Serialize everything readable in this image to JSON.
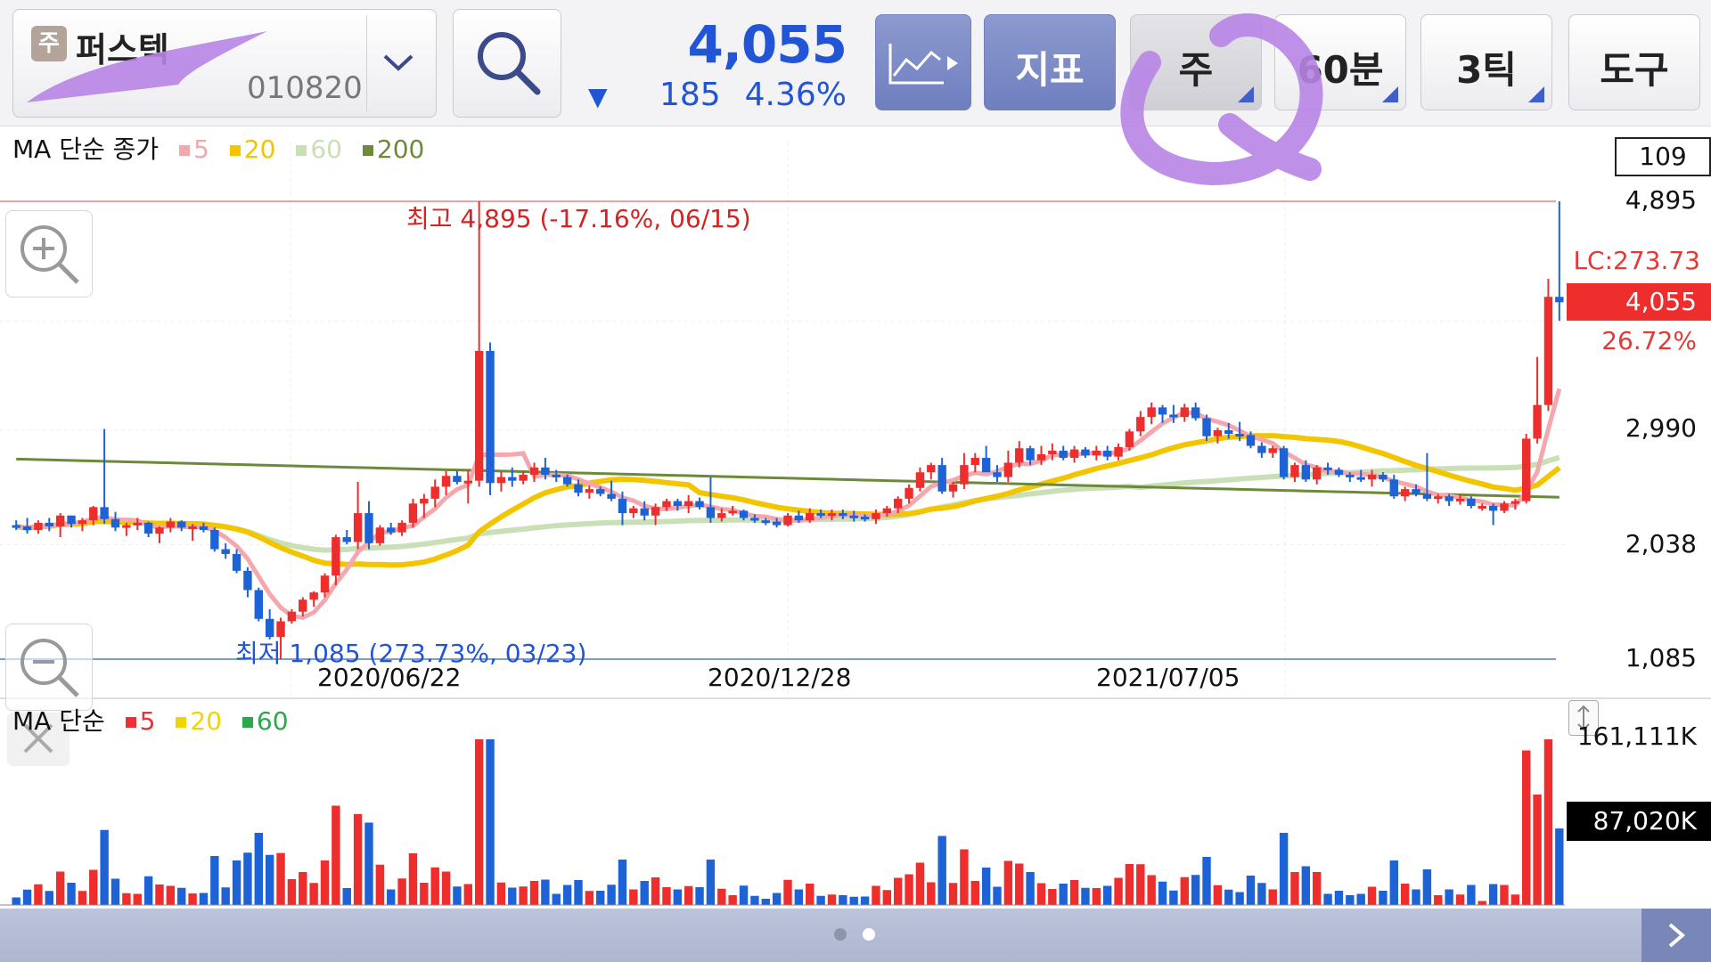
{
  "stock": {
    "badge": "주",
    "name": "퍼스텍",
    "code": "010820"
  },
  "quote": {
    "price": "4,055",
    "direction_arrow": "▼",
    "change": "185",
    "change_pct": "4.36%"
  },
  "toolbar": {
    "indicator_label": "지표",
    "period_label": "주",
    "minute_label": "60분",
    "tick_label": "3틱",
    "tools_label": "도구"
  },
  "price_panel": {
    "legend_title": "MA 단순 종가",
    "legend": [
      {
        "label": "5",
        "color": "#f4a7ad"
      },
      {
        "label": "20",
        "color": "#f2c500"
      },
      {
        "label": "60",
        "color": "#c9e0b7"
      },
      {
        "label": "200",
        "color": "#6d8a3a"
      }
    ],
    "count_box": "109",
    "high_flag": "최고 4,895 (-17.16%, 06/15)",
    "low_flag": "최저 1,085 (273.73%, 03/23)",
    "lc_label": "LC:273.73",
    "current_tag": "4,055",
    "current_pct": "26.72%"
  },
  "volume_panel": {
    "legend_title": "MA 단순",
    "legend": [
      {
        "label": "5",
        "color": "#f03030"
      },
      {
        "label": "20",
        "color": "#f2d500"
      },
      {
        "label": "60",
        "color": "#2aa84a"
      }
    ],
    "max_label": "161,111K",
    "current_tag": "87,020K"
  },
  "chart_data": {
    "type": "candlestick",
    "y_axis_ticks": [
      "4,895",
      "2,990",
      "2,038",
      "1,085"
    ],
    "x_axis_ticks": [
      "2020/06/22",
      "2020/12/28",
      "2021/07/05"
    ],
    "ylim": [
      1085,
      4895
    ],
    "colors": {
      "up": "#ee2d2d",
      "down": "#1e63d6"
    },
    "candles": [
      [
        2200,
        2240,
        2160,
        2190
      ],
      [
        2190,
        2260,
        2130,
        2160
      ],
      [
        2160,
        2240,
        2130,
        2220
      ],
      [
        2220,
        2260,
        2150,
        2190
      ],
      [
        2190,
        2300,
        2100,
        2280
      ],
      [
        2280,
        2280,
        2180,
        2210
      ],
      [
        2210,
        2260,
        2150,
        2240
      ],
      [
        2240,
        2360,
        2200,
        2350
      ],
      [
        2350,
        3000,
        2210,
        2250
      ],
      [
        2250,
        2310,
        2150,
        2180
      ],
      [
        2180,
        2220,
        2110,
        2200
      ],
      [
        2200,
        2260,
        2160,
        2220
      ],
      [
        2220,
        2230,
        2100,
        2130
      ],
      [
        2130,
        2190,
        2050,
        2180
      ],
      [
        2180,
        2260,
        2140,
        2230
      ],
      [
        2230,
        2240,
        2150,
        2180
      ],
      [
        2180,
        2210,
        2070,
        2190
      ],
      [
        2190,
        2220,
        2140,
        2160
      ],
      [
        2160,
        2180,
        1980,
        2000
      ],
      [
        2000,
        2050,
        1920,
        1960
      ],
      [
        1960,
        2000,
        1800,
        1820
      ],
      [
        1820,
        1850,
        1600,
        1660
      ],
      [
        1660,
        1680,
        1400,
        1420
      ],
      [
        1420,
        1500,
        1250,
        1270
      ],
      [
        1270,
        1430,
        1085,
        1400
      ],
      [
        1400,
        1500,
        1380,
        1480
      ],
      [
        1480,
        1600,
        1440,
        1580
      ],
      [
        1580,
        1650,
        1520,
        1640
      ],
      [
        1640,
        1800,
        1600,
        1780
      ],
      [
        1780,
        2120,
        1700,
        2100
      ],
      [
        2100,
        2160,
        2040,
        2060
      ],
      [
        2060,
        2560,
        2000,
        2300
      ],
      [
        2300,
        2400,
        2000,
        2050
      ],
      [
        2050,
        2200,
        2030,
        2180
      ],
      [
        2180,
        2220,
        2120,
        2140
      ],
      [
        2140,
        2240,
        2110,
        2220
      ],
      [
        2220,
        2420,
        2180,
        2380
      ],
      [
        2380,
        2460,
        2260,
        2420
      ],
      [
        2420,
        2580,
        2350,
        2520
      ],
      [
        2520,
        2650,
        2450,
        2610
      ],
      [
        2610,
        2650,
        2540,
        2560
      ],
      [
        2560,
        2660,
        2380,
        2570
      ],
      [
        2570,
        4895,
        2520,
        3650
      ],
      [
        3650,
        3720,
        2450,
        2550
      ],
      [
        2550,
        2650,
        2480,
        2600
      ],
      [
        2600,
        2680,
        2520,
        2570
      ],
      [
        2570,
        2650,
        2540,
        2620
      ],
      [
        2620,
        2720,
        2560,
        2680
      ],
      [
        2680,
        2760,
        2580,
        2620
      ],
      [
        2620,
        2660,
        2560,
        2600
      ],
      [
        2600,
        2620,
        2520,
        2540
      ],
      [
        2540,
        2580,
        2440,
        2470
      ],
      [
        2470,
        2530,
        2420,
        2500
      ],
      [
        2500,
        2520,
        2440,
        2460
      ],
      [
        2460,
        2570,
        2400,
        2420
      ],
      [
        2420,
        2480,
        2200,
        2300
      ],
      [
        2300,
        2360,
        2260,
        2340
      ],
      [
        2340,
        2400,
        2240,
        2280
      ],
      [
        2280,
        2380,
        2200,
        2350
      ],
      [
        2350,
        2420,
        2320,
        2400
      ],
      [
        2400,
        2420,
        2320,
        2360
      ],
      [
        2360,
        2450,
        2300,
        2400
      ],
      [
        2400,
        2430,
        2330,
        2350
      ],
      [
        2350,
        2600,
        2220,
        2260
      ],
      [
        2260,
        2340,
        2230,
        2300
      ],
      [
        2300,
        2360,
        2280,
        2320
      ],
      [
        2320,
        2330,
        2240,
        2260
      ],
      [
        2260,
        2290,
        2220,
        2240
      ],
      [
        2240,
        2260,
        2200,
        2230
      ],
      [
        2230,
        2260,
        2180,
        2200
      ],
      [
        2200,
        2300,
        2190,
        2280
      ],
      [
        2280,
        2320,
        2220,
        2240
      ],
      [
        2240,
        2340,
        2220,
        2300
      ],
      [
        2300,
        2330,
        2260,
        2280
      ],
      [
        2280,
        2330,
        2240,
        2300
      ],
      [
        2300,
        2330,
        2250,
        2280
      ],
      [
        2280,
        2320,
        2230,
        2270
      ],
      [
        2270,
        2290,
        2230,
        2250
      ],
      [
        2250,
        2330,
        2210,
        2300
      ],
      [
        2300,
        2360,
        2270,
        2340
      ],
      [
        2340,
        2440,
        2300,
        2420
      ],
      [
        2420,
        2540,
        2380,
        2510
      ],
      [
        2510,
        2680,
        2480,
        2640
      ],
      [
        2640,
        2720,
        2580,
        2700
      ],
      [
        2700,
        2760,
        2460,
        2480
      ],
      [
        2480,
        2560,
        2430,
        2540
      ],
      [
        2540,
        2800,
        2500,
        2700
      ],
      [
        2700,
        2800,
        2640,
        2760
      ],
      [
        2760,
        2860,
        2700,
        2640
      ],
      [
        2640,
        2700,
        2560,
        2600
      ],
      [
        2600,
        2820,
        2560,
        2720
      ],
      [
        2720,
        2900,
        2680,
        2840
      ],
      [
        2840,
        2860,
        2700,
        2740
      ],
      [
        2740,
        2860,
        2700,
        2790
      ],
      [
        2790,
        2880,
        2740,
        2820
      ],
      [
        2820,
        2860,
        2740,
        2760
      ],
      [
        2760,
        2860,
        2720,
        2830
      ],
      [
        2830,
        2850,
        2760,
        2780
      ],
      [
        2780,
        2860,
        2740,
        2820
      ],
      [
        2820,
        2860,
        2740,
        2770
      ],
      [
        2770,
        2880,
        2740,
        2850
      ],
      [
        2850,
        3000,
        2820,
        2980
      ],
      [
        2980,
        3150,
        2940,
        3100
      ],
      [
        3100,
        3220,
        3040,
        3180
      ],
      [
        3180,
        3200,
        3050,
        3120
      ],
      [
        3120,
        3200,
        3050,
        3100
      ],
      [
        3100,
        3210,
        3060,
        3180
      ],
      [
        3180,
        3220,
        3070,
        3090
      ],
      [
        3090,
        3120,
        2900,
        2940
      ],
      [
        2940,
        3010,
        2880,
        2990
      ],
      [
        2990,
        3050,
        2920,
        2960
      ],
      [
        2960,
        3060,
        2900,
        2950
      ],
      [
        2950,
        2980,
        2840,
        2860
      ],
      [
        2860,
        2890,
        2760,
        2800
      ],
      [
        2800,
        2860,
        2760,
        2840
      ],
      [
        2840,
        2860,
        2580,
        2600
      ],
      [
        2600,
        2720,
        2560,
        2700
      ],
      [
        2700,
        2740,
        2560,
        2580
      ],
      [
        2580,
        2700,
        2540,
        2680
      ],
      [
        2680,
        2720,
        2620,
        2660
      ],
      [
        2660,
        2680,
        2600,
        2620
      ],
      [
        2620,
        2640,
        2560,
        2600
      ],
      [
        2600,
        2660,
        2560,
        2580
      ],
      [
        2580,
        2660,
        2520,
        2620
      ],
      [
        2620,
        2640,
        2560,
        2580
      ],
      [
        2580,
        2620,
        2420,
        2440
      ],
      [
        2440,
        2520,
        2400,
        2500
      ],
      [
        2500,
        2540,
        2440,
        2460
      ],
      [
        2460,
        2800,
        2400,
        2420
      ],
      [
        2420,
        2460,
        2380,
        2440
      ],
      [
        2440,
        2460,
        2360,
        2400
      ],
      [
        2400,
        2460,
        2370,
        2420
      ],
      [
        2420,
        2440,
        2340,
        2360
      ],
      [
        2360,
        2380,
        2320,
        2360
      ],
      [
        2360,
        2380,
        2200,
        2320
      ],
      [
        2320,
        2400,
        2300,
        2380
      ],
      [
        2380,
        2420,
        2330,
        2400
      ],
      [
        2400,
        2960,
        2380,
        2920
      ],
      [
        2920,
        3600,
        2880,
        3200
      ],
      [
        3200,
        4250,
        3150,
        4100
      ],
      [
        4100,
        4895,
        3900,
        4055
      ]
    ]
  }
}
